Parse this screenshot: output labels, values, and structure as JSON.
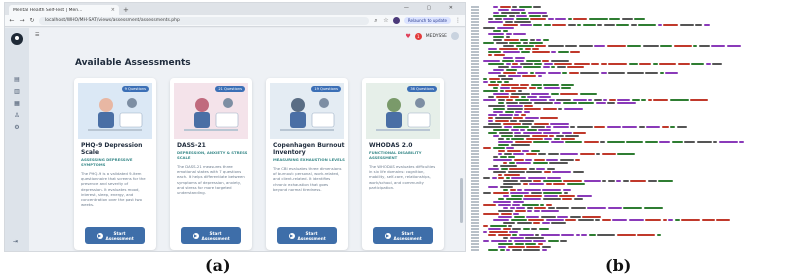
{
  "labels": {
    "a": "(a)",
    "b": "(b)"
  },
  "browser": {
    "tab_title": "Mental Health Self-Test | Men...",
    "url": "localhost/WHO/MH-SAT/views/assessment/assessments.php",
    "update_label": "Relaunch to update",
    "window_controls": "— ▢ ✕"
  },
  "app": {
    "page_title": "Available Assessments",
    "user_name": "MEDYSSE",
    "notif_count": "1",
    "sidebar_icons": [
      "home-icon",
      "chart-icon",
      "document-icon",
      "people-icon",
      "settings-icon"
    ]
  },
  "cards": [
    {
      "title": "PHQ-9 Depression Scale",
      "subtitle": "ASSESSING DEPRESSIVE SYMPTOMS",
      "questions": "9 Questions",
      "description": "The PHQ-9 is a validated 9-item questionnaire that screens for the presence and severity of depression. It evaluates mood, interest, sleep, energy, and concentration over the past two weeks.",
      "button": "Start Assessment",
      "illus_color": "#dbe8f5",
      "accent": "#e8b7a3"
    },
    {
      "title": "DASS-21",
      "subtitle": "DEPRESSION, ANXIETY & STRESS SCALE",
      "questions": "21 Questions",
      "description": "The DASS-21 measures three emotional states with 7 questions each. It helps differentiate between symptoms of depression, anxiety, and stress for more targeted understanding.",
      "button": "Start Assessment",
      "illus_color": "#f4e3ea",
      "accent": "#c06a7d"
    },
    {
      "title": "Copenhagen Burnout Inventory",
      "subtitle": "MEASURING EXHAUSTION LEVELS",
      "questions": "19 Questions",
      "description": "The CBI evaluates three dimensions of burnout: personal, work-related, and client-related. It identifies chronic exhaustion that goes beyond normal tiredness.",
      "button": "Start Assessment",
      "illus_color": "#e4ecf3",
      "accent": "#5a6d84"
    },
    {
      "title": "WHODAS 2.0",
      "subtitle": "FUNCTIONAL DISABILITY ASSESSMENT",
      "questions": "36 Questions",
      "description": "The WHODAS evaluates difficulties in six life domains: cognition, mobility, self-care, relationships, work/school, and community participation.",
      "button": "Start Assessment",
      "illus_color": "#e6efe9",
      "accent": "#7a9a6a"
    }
  ],
  "code_colors": {
    "tag": "#8a3ab9",
    "attr": "#2f7d32",
    "string": "#c0392b",
    "text": "#555555"
  }
}
